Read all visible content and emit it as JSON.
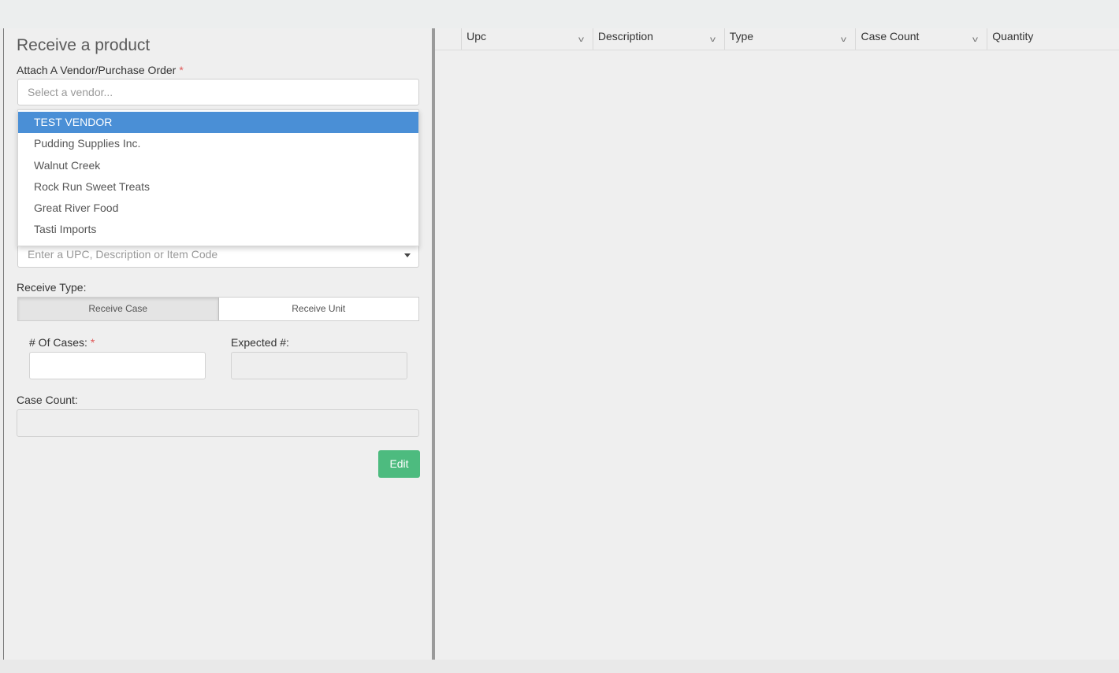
{
  "form": {
    "title": "Receive a product",
    "vendor_label": "Attach A Vendor/Purchase Order",
    "required_mark": "*",
    "vendor_placeholder": "Select a vendor...",
    "vendor_options": [
      "TEST VENDOR",
      "Pudding Supplies Inc.",
      "Walnut Creek",
      "Rock Run Sweet Treats",
      "Great River Food",
      "Tasti Imports"
    ],
    "selected_vendor_index": 0,
    "upc_placeholder": "Enter a UPC, Description or Item Code",
    "receive_type_label": "Receive Type:",
    "receive_case_label": "Receive Case",
    "receive_unit_label": "Receive Unit",
    "active_receive_type": "Receive Case",
    "cases_label": "# Of Cases:",
    "expected_label": "Expected #:",
    "case_count_label": "Case Count:",
    "edit_label": "Edit"
  },
  "grid": {
    "columns": [
      "Upc",
      "Description",
      "Type",
      "Case Count",
      "Quantity"
    ]
  },
  "colors": {
    "selected_option": "#4a8fd6",
    "edit_button": "#4dbb7f",
    "required": "#e05a5a"
  }
}
